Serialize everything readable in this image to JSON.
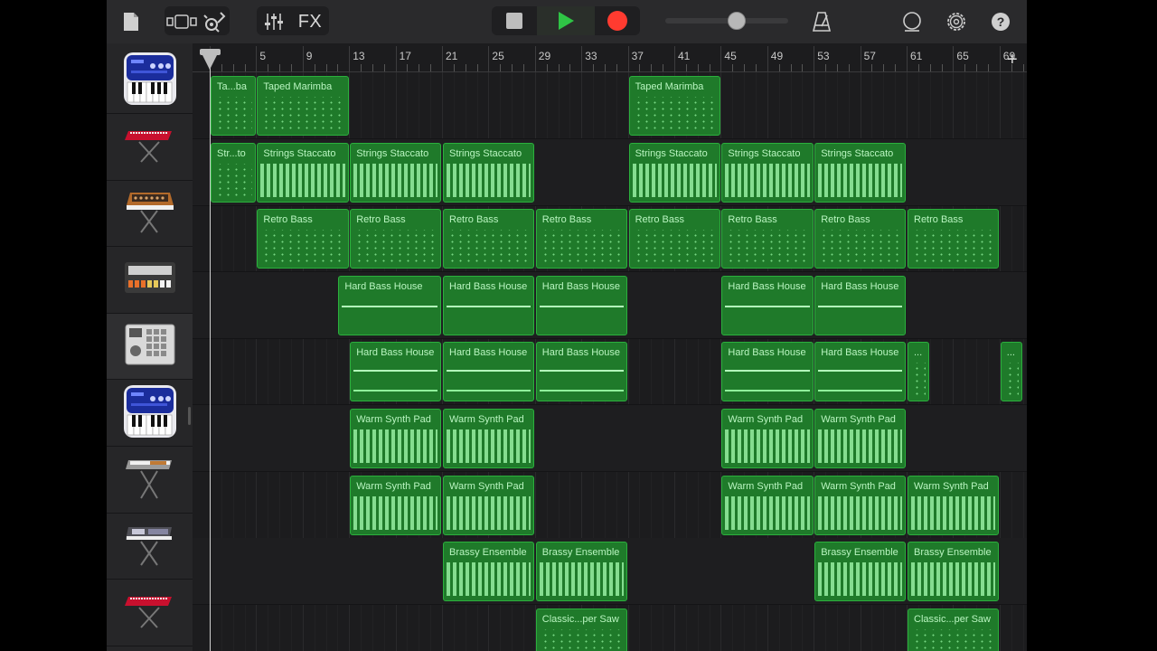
{
  "toolbar": {
    "fx_label": "FX",
    "icons": [
      "document-icon",
      "view-toggle-icon",
      "guitar-icon",
      "mixer-icon",
      "stop-icon",
      "play-icon",
      "record-icon",
      "metronome-icon",
      "loop-icon",
      "settings-icon",
      "help-icon"
    ],
    "master_volume": 0.58,
    "colors": {
      "play": "#2fc445",
      "record": "#ff3b30",
      "region_fill": "#1f7a2a",
      "region_border": "#2bb03d"
    }
  },
  "ruler": {
    "bar_numbers": [
      "5",
      "9",
      "13",
      "17",
      "21",
      "25",
      "29",
      "33",
      "37",
      "41",
      "45",
      "49",
      "53",
      "57",
      "61",
      "65",
      "69"
    ],
    "add_label": "+"
  },
  "tracks": [
    {
      "instrument": "keyboard-synth-icon",
      "regions": [
        {
          "label": "Ta...ba",
          "start": 1,
          "end": 5
        },
        {
          "label": "Taped Marimba",
          "start": 5,
          "end": 13
        },
        {
          "label": "Taped Marimba",
          "start": 37,
          "end": 45
        }
      ]
    },
    {
      "instrument": "red-keyboard-icon",
      "regions": [
        {
          "label": "Str...to",
          "start": 1,
          "end": 5
        },
        {
          "label": "Strings Staccato",
          "start": 5,
          "end": 13
        },
        {
          "label": "Strings Staccato",
          "start": 13,
          "end": 21
        },
        {
          "label": "Strings Staccato",
          "start": 21,
          "end": 29
        },
        {
          "label": "Strings Staccato",
          "start": 37,
          "end": 45
        },
        {
          "label": "Strings Staccato",
          "start": 45,
          "end": 53
        },
        {
          "label": "Strings Staccato",
          "start": 53,
          "end": 61
        }
      ]
    },
    {
      "instrument": "analog-synth-icon",
      "regions": [
        {
          "label": "Retro Bass",
          "start": 5,
          "end": 13
        },
        {
          "label": "Retro Bass",
          "start": 13,
          "end": 21
        },
        {
          "label": "Retro Bass",
          "start": 21,
          "end": 29
        },
        {
          "label": "Retro Bass",
          "start": 29,
          "end": 37
        },
        {
          "label": "Retro Bass",
          "start": 37,
          "end": 45
        },
        {
          "label": "Retro Bass",
          "start": 45,
          "end": 53
        },
        {
          "label": "Retro Bass",
          "start": 53,
          "end": 61
        },
        {
          "label": "Retro Bass",
          "start": 61,
          "end": 69
        }
      ]
    },
    {
      "instrument": "drum-machine-icon",
      "regions": [
        {
          "label": "Hard Bass House",
          "start": 12,
          "end": 21
        },
        {
          "label": "Hard Bass House",
          "start": 21,
          "end": 29
        },
        {
          "label": "Hard Bass House",
          "start": 29,
          "end": 37
        },
        {
          "label": "Hard Bass House",
          "start": 45,
          "end": 53
        },
        {
          "label": "Hard Bass House",
          "start": 53,
          "end": 61
        }
      ]
    },
    {
      "instrument": "beat-sampler-icon",
      "regions": [
        {
          "label": "Hard Bass House",
          "start": 13,
          "end": 21
        },
        {
          "label": "Hard Bass House",
          "start": 21,
          "end": 29
        },
        {
          "label": "Hard Bass House",
          "start": 29,
          "end": 37
        },
        {
          "label": "Hard Bass House",
          "start": 45,
          "end": 53
        },
        {
          "label": "Hard Bass House",
          "start": 53,
          "end": 61
        },
        {
          "label": "...",
          "start": 61,
          "end": 63
        },
        {
          "label": "...",
          "start": 69,
          "end": 71
        }
      ]
    },
    {
      "instrument": "keyboard-synth-icon",
      "regions": [
        {
          "label": "Warm Synth Pad",
          "start": 13,
          "end": 21
        },
        {
          "label": "Warm Synth Pad",
          "start": 21,
          "end": 29
        },
        {
          "label": "Warm Synth Pad",
          "start": 45,
          "end": 53
        },
        {
          "label": "Warm Synth Pad",
          "start": 53,
          "end": 61
        }
      ]
    },
    {
      "instrument": "keyboard-stand-icon",
      "regions": [
        {
          "label": "Warm Synth Pad",
          "start": 13,
          "end": 21
        },
        {
          "label": "Warm Synth Pad",
          "start": 21,
          "end": 29
        },
        {
          "label": "Warm Synth Pad",
          "start": 45,
          "end": 53
        },
        {
          "label": "Warm Synth Pad",
          "start": 53,
          "end": 61
        },
        {
          "label": "Warm Synth Pad",
          "start": 61,
          "end": 69
        }
      ]
    },
    {
      "instrument": "workstation-keyboard-icon",
      "regions": [
        {
          "label": "Brassy Ensemble",
          "start": 21,
          "end": 29
        },
        {
          "label": "Brassy Ensemble",
          "start": 29,
          "end": 37
        },
        {
          "label": "Brassy Ensemble",
          "start": 53,
          "end": 61
        },
        {
          "label": "Brassy Ensemble",
          "start": 61,
          "end": 69
        }
      ]
    },
    {
      "instrument": "red-keyboard-icon",
      "regions": [
        {
          "label": "Classic...per Saw",
          "start": 29,
          "end": 37
        },
        {
          "label": "Classic...per Saw",
          "start": 61,
          "end": 69
        }
      ]
    }
  ],
  "playhead_bar": 1
}
